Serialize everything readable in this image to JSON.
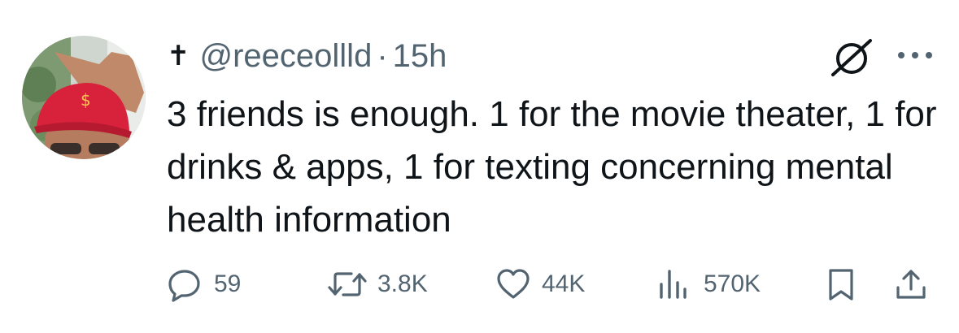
{
  "post": {
    "handle_prefix_symbol": "✝",
    "handle": "@reeceollld",
    "separator": "·",
    "time": "15h",
    "text": "3 friends is enough. 1 for the movie theater, 1 for drinks & apps, 1 for texting concerning mental health information"
  },
  "header_icons": {
    "grok": "grok-icon",
    "more": "more-icon"
  },
  "actions": {
    "replies": "59",
    "reposts": "3.8K",
    "likes": "44K",
    "views": "570K",
    "icons": [
      "reply-icon",
      "repost-icon",
      "like-icon",
      "views-icon",
      "bookmark-icon",
      "share-icon"
    ]
  },
  "colors": {
    "text_primary": "#0f1419",
    "text_secondary": "#536471",
    "background": "#ffffff"
  }
}
